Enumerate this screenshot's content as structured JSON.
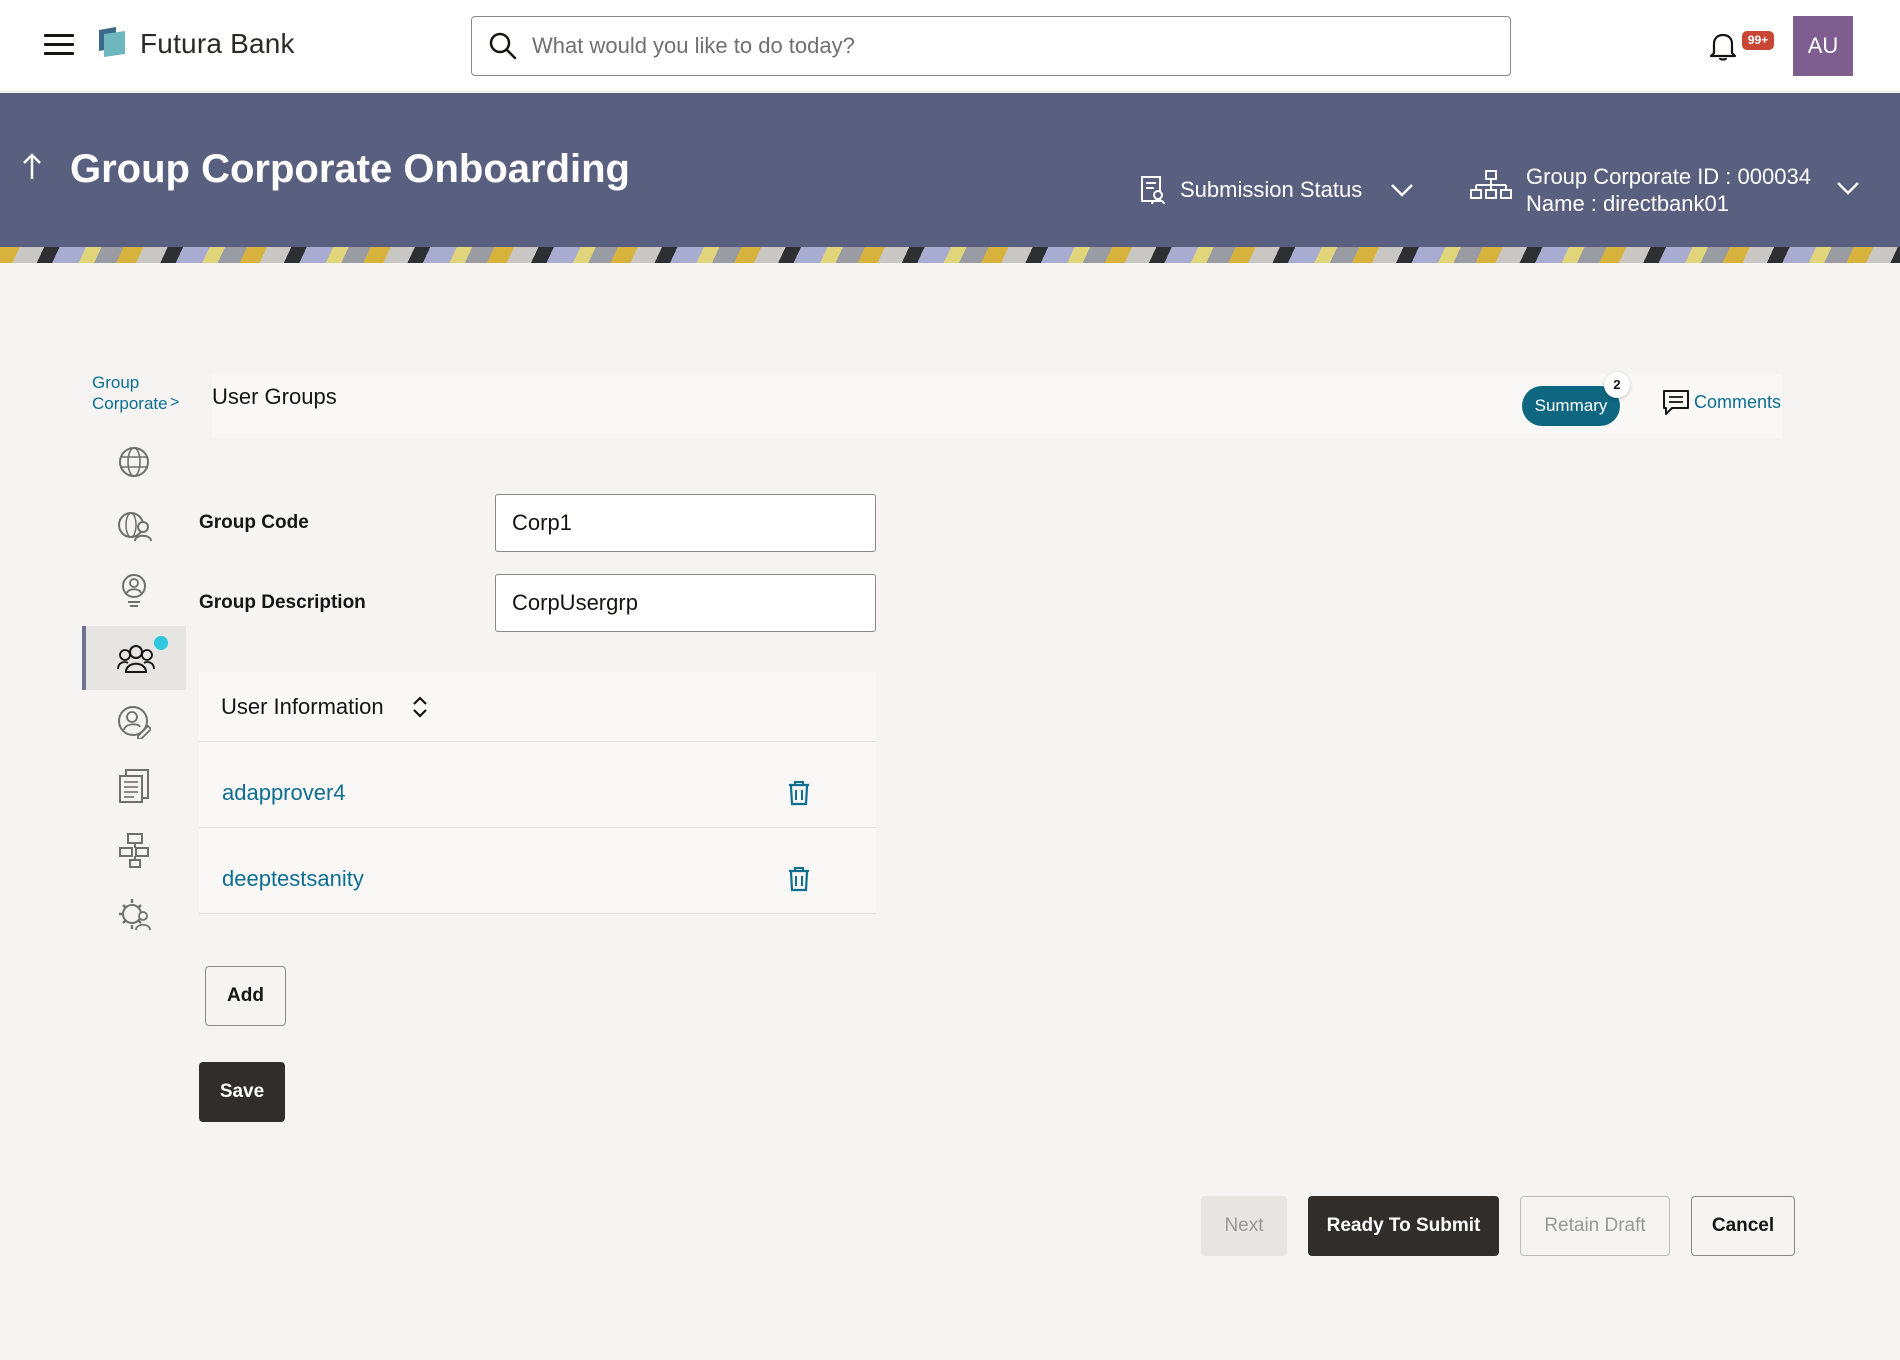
{
  "topbar": {
    "brand": "Futura Bank",
    "search_placeholder": "What would you like to do today?",
    "notification_badge": "99+",
    "avatar_initials": "AU"
  },
  "header": {
    "title": "Group Corporate Onboarding",
    "submission_status_label": "Submission Status",
    "group_corporate_id": "Group Corporate ID : 000034",
    "name": "Name : directbank01"
  },
  "sidebar": {
    "breadcrumb_line1": "Group",
    "breadcrumb_line2": "Corporate",
    "breadcrumb_arrow": ">"
  },
  "section": {
    "title": "User Groups",
    "summary_label": "Summary",
    "summary_count": "2",
    "comments_label": "Comments"
  },
  "form": {
    "group_code_label": "Group Code",
    "group_code_value": "Corp1",
    "group_description_label": "Group Description",
    "group_description_value": "CorpUsergrp"
  },
  "user_info": {
    "title": "User Information",
    "users": [
      "adapprover4",
      "deeptestsanity"
    ]
  },
  "buttons": {
    "add": "Add",
    "save": "Save",
    "next": "Next",
    "ready_to_submit": "Ready To Submit",
    "retain_draft": "Retain Draft",
    "cancel": "Cancel"
  },
  "colors": {
    "banner": "#59607f",
    "primary_link": "#0d6e92",
    "summary_pill": "#0e6681",
    "dark_button": "#312d2a",
    "badge": "#c74634",
    "avatar": "#7e5e8e",
    "active_dot": "#2ec7df"
  }
}
